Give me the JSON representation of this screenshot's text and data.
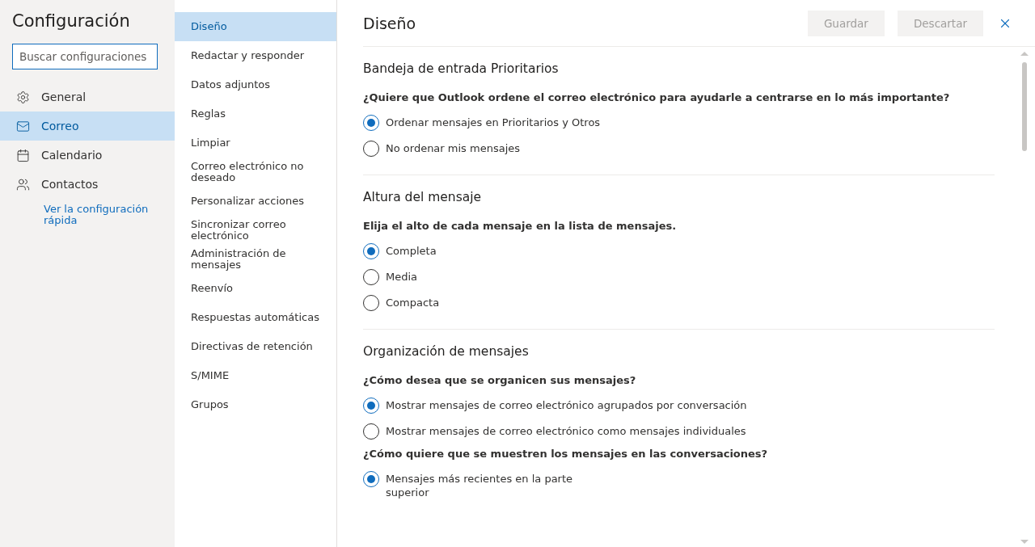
{
  "sidebar": {
    "title": "Configuración",
    "search": {
      "placeholder": "Buscar configuraciones"
    },
    "items": [
      {
        "label": "General",
        "selected": false
      },
      {
        "label": "Correo",
        "selected": true
      },
      {
        "label": "Calendario",
        "selected": false
      },
      {
        "label": "Contactos",
        "selected": false
      }
    ],
    "link": "Ver la configuración rápida"
  },
  "subnav": {
    "items": [
      {
        "label": "Diseño",
        "selected": true
      },
      {
        "label": "Redactar y responder",
        "selected": false
      },
      {
        "label": "Datos adjuntos",
        "selected": false
      },
      {
        "label": "Reglas",
        "selected": false
      },
      {
        "label": "Limpiar",
        "selected": false
      },
      {
        "label": "Correo electrónico no deseado",
        "selected": false
      },
      {
        "label": "Personalizar acciones",
        "selected": false
      },
      {
        "label": "Sincronizar correo electrónico",
        "selected": false
      },
      {
        "label": "Administración de mensajes",
        "selected": false
      },
      {
        "label": "Reenvío",
        "selected": false
      },
      {
        "label": "Respuestas automáticas",
        "selected": false
      },
      {
        "label": "Directivas de retención",
        "selected": false
      },
      {
        "label": "S/MIME",
        "selected": false
      },
      {
        "label": "Grupos",
        "selected": false
      }
    ]
  },
  "panel": {
    "title": "Diseño",
    "buttons": [
      {
        "label": "Guardar",
        "disabled": true
      },
      {
        "label": "Descartar",
        "disabled": true
      }
    ],
    "sections": [
      {
        "title": "Bandeja de entrada Prioritarios",
        "groups": [
          {
            "question": "¿Quiere que Outlook ordene el correo electrónico para ayudarle a centrarse en lo más importante?",
            "options": [
              {
                "label": "Ordenar mensajes en Prioritarios y Otros",
                "selected": true
              },
              {
                "label": "No ordenar mis mensajes",
                "selected": false
              }
            ]
          }
        ]
      },
      {
        "title": "Altura del mensaje",
        "groups": [
          {
            "question": "Elija el alto de cada mensaje en la lista de mensajes.",
            "options": [
              {
                "label": "Completa",
                "selected": true
              },
              {
                "label": "Media",
                "selected": false
              },
              {
                "label": "Compacta",
                "selected": false
              }
            ]
          }
        ]
      },
      {
        "title": "Organización de mensajes",
        "groups": [
          {
            "question": "¿Cómo desea que se organicen sus mensajes?",
            "options": [
              {
                "label": "Mostrar mensajes de correo electrónico agrupados por conversación",
                "selected": true
              },
              {
                "label": "Mostrar mensajes de correo electrónico como mensajes individuales",
                "selected": false
              }
            ]
          },
          {
            "question": "¿Cómo quiere que se muestren los mensajes en las conversaciones?",
            "options": [
              {
                "label": "Mensajes más recientes en la parte superior",
                "selected": true
              }
            ]
          }
        ]
      }
    ]
  }
}
